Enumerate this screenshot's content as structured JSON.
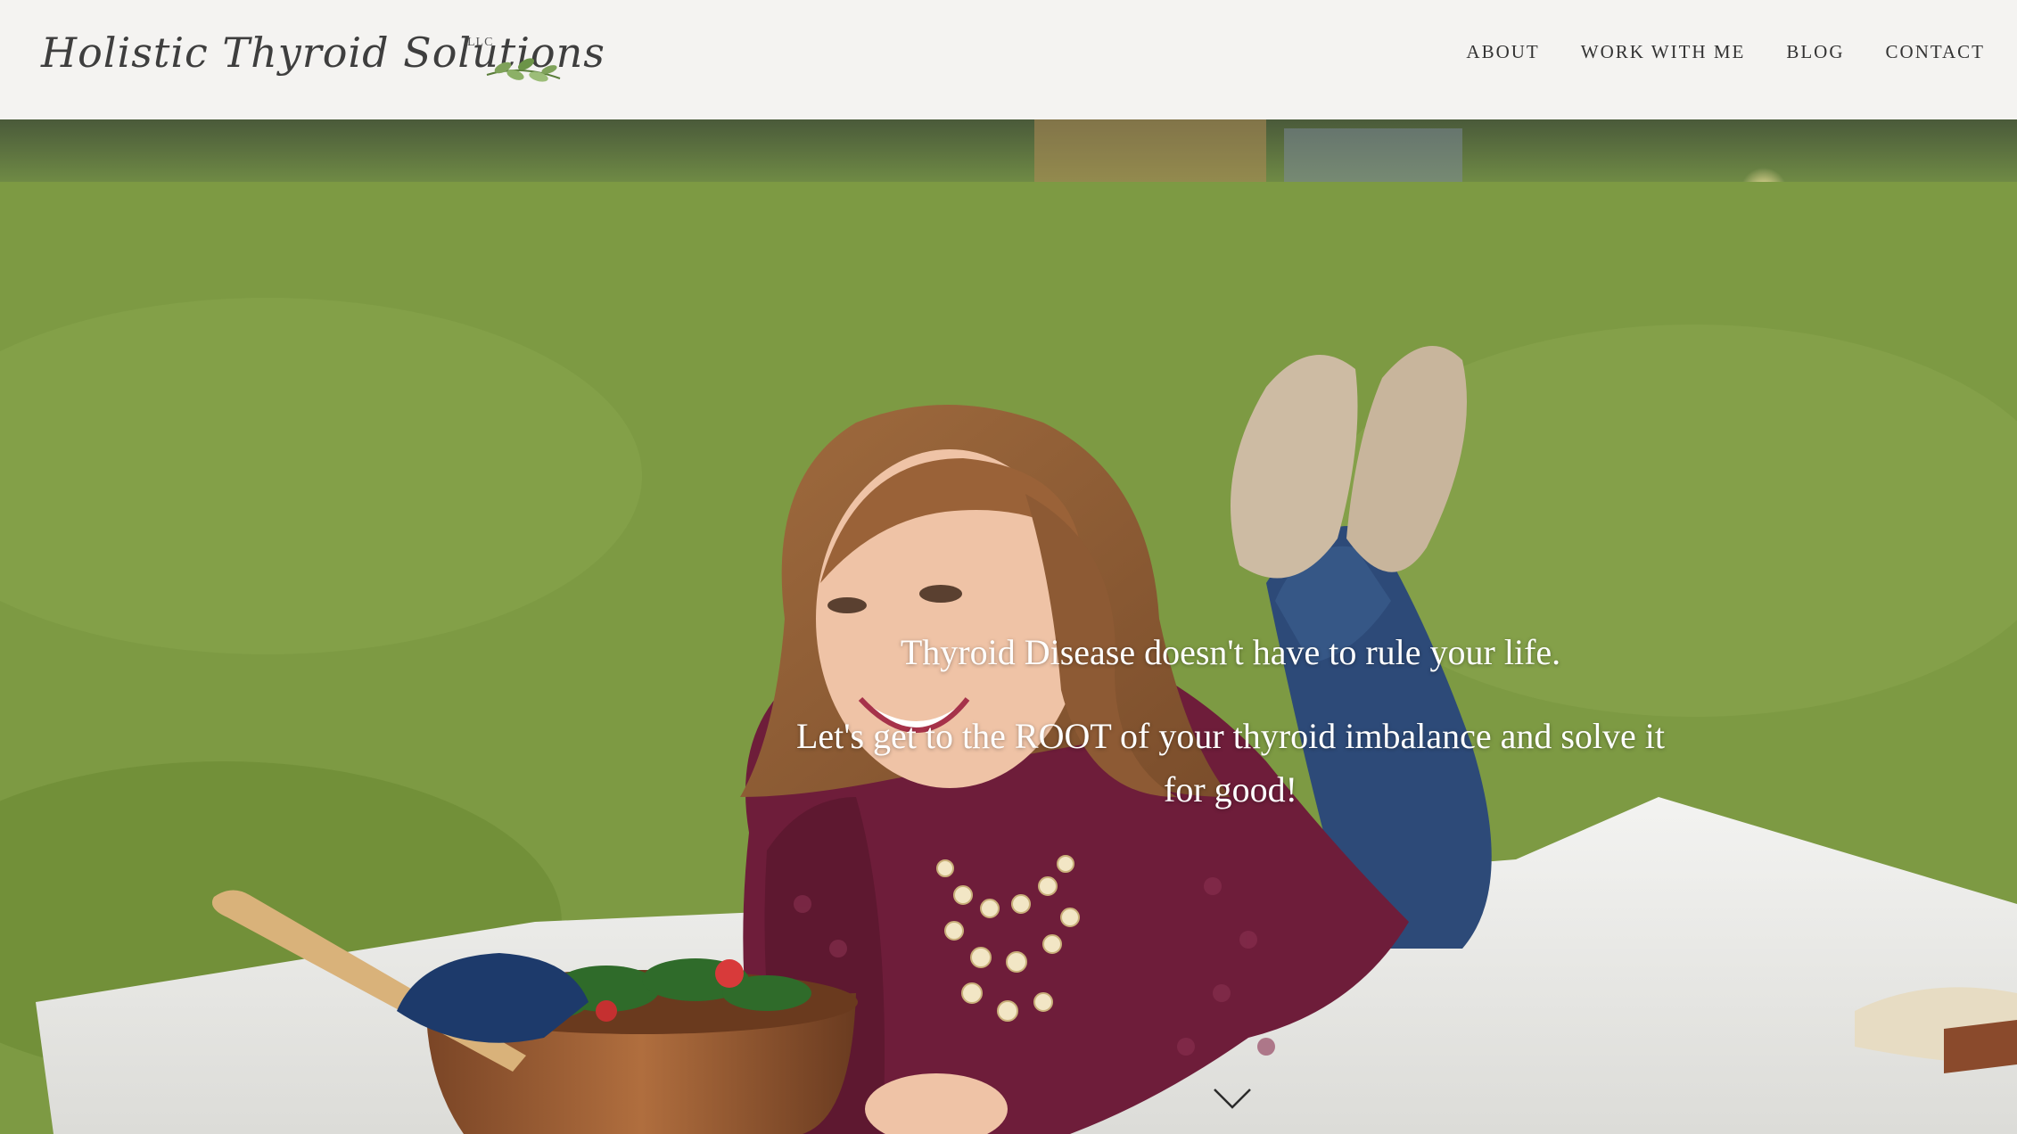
{
  "header": {
    "logo_text": "Holistic Thyroid Solutions",
    "logo_suffix": "LLC"
  },
  "nav": {
    "items": [
      {
        "label": "ABOUT"
      },
      {
        "label": "WORK WITH ME"
      },
      {
        "label": "BLOG"
      },
      {
        "label": "CONTACT"
      }
    ]
  },
  "hero": {
    "headline": "Thyroid Disease doesn't have to rule your life.",
    "subheadline": "Let's get to the ROOT of your thyroid imbalance and solve it for good!",
    "scroll_icon": "chevron-down-icon"
  },
  "colors": {
    "header_bg": "#f4f3f1",
    "nav_text": "#333333",
    "hero_text": "#ffffff",
    "grass": "#7a9741",
    "sweater": "#6e1d3a",
    "blanket": "#eeeeec"
  }
}
